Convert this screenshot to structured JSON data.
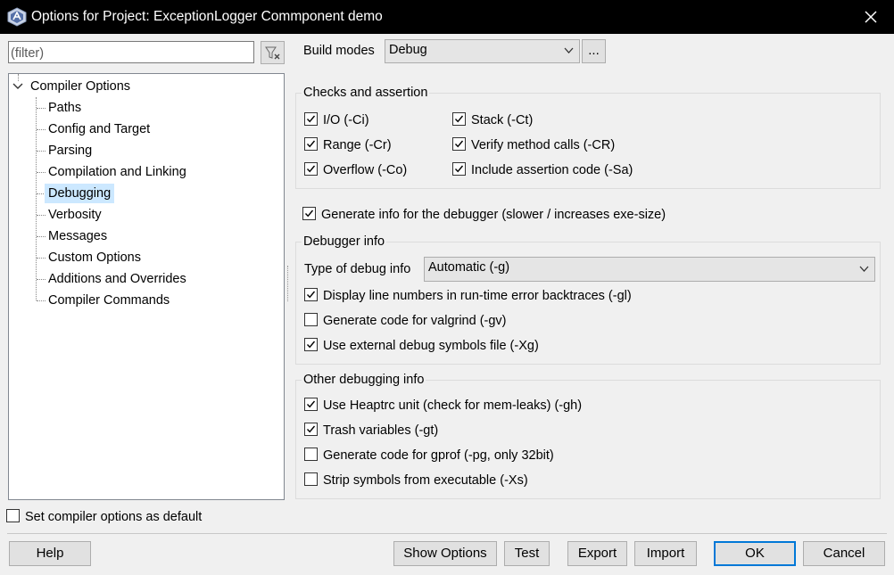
{
  "window": {
    "title": "Options for Project: ExceptionLogger Commponent demo"
  },
  "filter": {
    "placeholder": "(filter)"
  },
  "tree": {
    "root": "Compiler Options",
    "items": [
      "Paths",
      "Config and Target",
      "Parsing",
      "Compilation and Linking",
      "Debugging",
      "Verbosity",
      "Messages",
      "Custom Options",
      "Additions and Overrides",
      "Compiler Commands"
    ],
    "selected": "Debugging"
  },
  "build_modes": {
    "label": "Build modes",
    "value": "Debug",
    "more_button": "..."
  },
  "checks": {
    "title": "Checks and assertion",
    "io": {
      "label": "I/O (-Ci)",
      "checked": true
    },
    "range": {
      "label": "Range (-Cr)",
      "checked": true
    },
    "overflow": {
      "label": "Overflow (-Co)",
      "checked": true
    },
    "stack": {
      "label": "Stack (-Ct)",
      "checked": true
    },
    "verify": {
      "label": "Verify method calls (-CR)",
      "checked": true
    },
    "assert": {
      "label": "Include assertion code (-Sa)",
      "checked": true
    }
  },
  "generate_debug_info": {
    "label": "Generate info for the debugger (slower / increases exe-size)",
    "checked": true
  },
  "debugger_info": {
    "title": "Debugger info",
    "type_label": "Type of debug info",
    "type_value": "Automatic (-g)",
    "line_numbers": {
      "label": "Display line numbers in run-time error backtraces (-gl)",
      "checked": true
    },
    "valgrind": {
      "label": "Generate code for valgrind (-gv)",
      "checked": false
    },
    "external_symbols": {
      "label": "Use external debug symbols file (-Xg)",
      "checked": true
    }
  },
  "other_debugging": {
    "title": "Other debugging info",
    "heaptrc": {
      "label": "Use Heaptrc unit (check for mem-leaks) (-gh)",
      "checked": true
    },
    "trash": {
      "label": "Trash variables (-gt)",
      "checked": true
    },
    "gprof": {
      "label": "Generate code for gprof (-pg, only 32bit)",
      "checked": false
    },
    "strip": {
      "label": "Strip symbols from executable (-Xs)",
      "checked": false
    }
  },
  "set_default": {
    "label": "Set compiler options as default",
    "checked": false
  },
  "buttons": {
    "help": "Help",
    "show_options": "Show Options",
    "test": "Test",
    "export": "Export",
    "import": "Import",
    "ok": "OK",
    "cancel": "Cancel"
  },
  "colors": {
    "titlebar": "#000000",
    "selection": "#cce8ff",
    "default_button_border": "#0078d7"
  }
}
